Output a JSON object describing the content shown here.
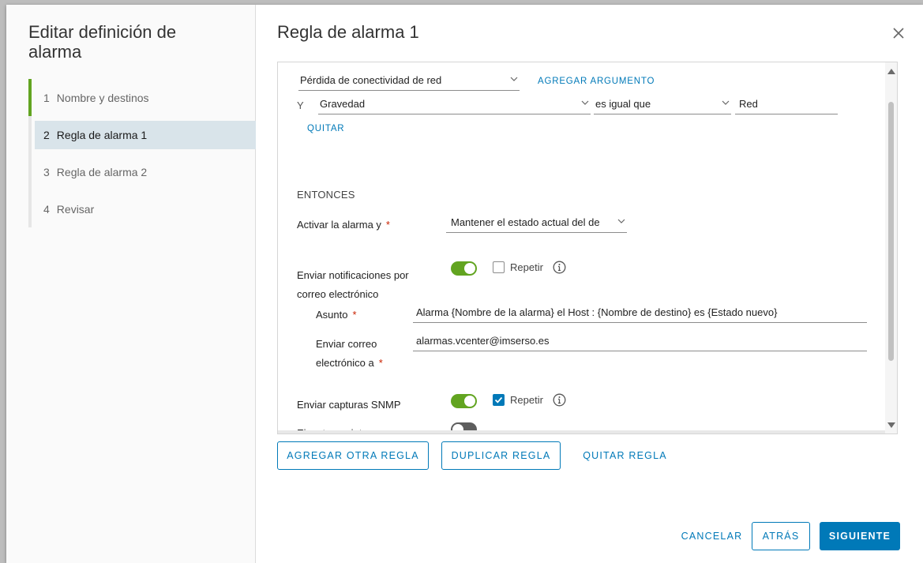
{
  "wizard": {
    "title": "Editar definición de alarma",
    "steps": [
      {
        "num": "1",
        "label": "Nombre y destinos"
      },
      {
        "num": "2",
        "label": "Regla de alarma 1"
      },
      {
        "num": "3",
        "label": "Regla de alarma 2"
      },
      {
        "num": "4",
        "label": "Revisar"
      }
    ],
    "active_step": 2
  },
  "panel": {
    "title": "Regla de alarma 1",
    "close_icon": "close-icon"
  },
  "rule": {
    "trigger_value": "Pérdida de conectividad de red",
    "add_argument": "AGREGAR ARGUMENTO",
    "and_label": "Y",
    "argument": "Gravedad",
    "operator": "es igual que",
    "argument_value": "Red",
    "remove_label": "QUITAR",
    "then_label": "ENTONCES",
    "trigger_alarm_label": "Activar la alarma y",
    "trigger_alarm_value": "Mantener el estado actual del de",
    "email_label_1": "Enviar notificaciones por",
    "email_label_2": "correo electrónico",
    "email_toggle": true,
    "email_repeat_label": "Repetir",
    "email_repeat_checked": false,
    "subject_label": "Asunto",
    "subject_value": "Alarma {Nombre de la alarma} el Host : {Nombre de destino} es {Estado nuevo}",
    "send_to_label_1": "Enviar correo",
    "send_to_label_2": "electrónico a",
    "send_to_value": "alarmas.vcenter@imserso.es",
    "snmp_label": "Enviar capturas SNMP",
    "snmp_toggle": true,
    "snmp_repeat_label": "Repetir",
    "snmp_repeat_checked": true,
    "script_label": "Ejecutar script",
    "script_toggle": false,
    "required_mark": "*"
  },
  "rule_actions": {
    "add_rule": "AGREGAR OTRA REGLA",
    "duplicate_rule": "DUPLICAR REGLA",
    "remove_rule": "QUITAR REGLA"
  },
  "footer": {
    "cancel": "CANCELAR",
    "back": "ATRÁS",
    "next": "SIGUIENTE"
  },
  "colors": {
    "accent": "#0079b8",
    "toggle_on": "#62a420",
    "required": "#c92100"
  }
}
